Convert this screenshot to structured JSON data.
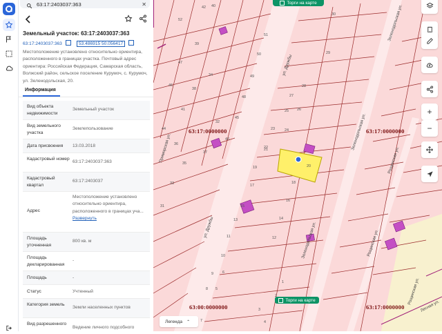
{
  "search": {
    "value": "63:17:2403037:363"
  },
  "parcel": {
    "title": "Земельный участок: 63:17:2403037:363",
    "cadastral_chip": "63:17:2403037:363",
    "coords_chip": "53.486915 50.056417",
    "description": "Местоположение установлено относительно ориентира, расположенного в границах участка. Почтовый адрес ориентира: Российская Федерация, Самарская область, Волжский район, сельское поселение Курумоч, с. Курумоч, ул. Зеленодольская, 20."
  },
  "tabs": {
    "info": "Информация"
  },
  "rows": [
    {
      "label": "Вид объекта недвижимости",
      "value": "Земельный участок"
    },
    {
      "label": "Вид земельного участка",
      "value": "Землепользование"
    },
    {
      "label": "Дата присвоения",
      "value": "13.03.2018"
    },
    {
      "label": "Кадастровый номер",
      "value": "63:17:2403037:363"
    },
    {
      "label": "Кадастровый квартал",
      "value": "63:17:2403037"
    },
    {
      "label": "Адрес",
      "value": "Местоположение установлено относительно ориентира, расположенного в границах уча...",
      "link": "Развернуть"
    },
    {
      "label": "Площадь уточненная",
      "value": "800 кв. м"
    },
    {
      "label": "Площадь декларированная",
      "value": "-"
    },
    {
      "label": "Площадь",
      "value": "-"
    },
    {
      "label": "Статус",
      "value": "Учтенный"
    },
    {
      "label": "Категория земель",
      "value": "Земли населенных пунктов"
    },
    {
      "label": "Вид разрешенного",
      "value": "Ведение личного подсобного"
    }
  ],
  "map": {
    "top_button": "Торги на карте",
    "bottom_button": "Торги на карте",
    "legend": "Легенда",
    "cadastral_labels": [
      "63:17:0000000",
      "63:17:0000000",
      "63:00:0000000",
      "63:17:0000000"
    ],
    "streets": [
      "ул. Дружбы",
      "ул. Дружбы",
      "Зеленодольская ул.",
      "Зеленодольская ул.",
      "Зеленодольская ул.",
      "Рощинская ул.",
      "Рощинская ул.",
      "Рощинская ул.",
      "Лесная ул.",
      "Приморская ул."
    ],
    "parcel_numbers": [
      "51",
      "52",
      "50",
      "49",
      "47",
      "48",
      "46",
      "45",
      "44",
      "43",
      "42",
      "41",
      "40",
      "39",
      "38",
      "37",
      "36",
      "35",
      "34",
      "33",
      "32",
      "31",
      "30",
      "29",
      "28",
      "27",
      "26",
      "25",
      "24",
      "23",
      "22",
      "21",
      "20",
      "19",
      "18",
      "17",
      "16",
      "15",
      "14",
      "13",
      "12",
      "11",
      "10",
      "9",
      "8",
      "7",
      "6",
      "5",
      "4",
      "3",
      "2",
      "1"
    ],
    "selected_parcel": "20",
    "colors": {
      "background": "#fbd9d9",
      "boundary": "#9a2a2a",
      "selected": "#fff06a",
      "building": "#c44fc4",
      "marker": "#2b66d9"
    }
  }
}
